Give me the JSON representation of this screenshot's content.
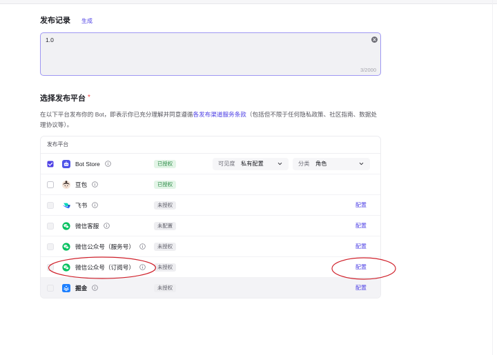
{
  "record": {
    "title": "发布记录",
    "generate_label": "生成",
    "value": "1.0",
    "counter": "3/2000"
  },
  "platform": {
    "title": "选择发布平台",
    "required_mark": "*",
    "desc_prefix": "在以下平台发布你的 Bot，即表示你已充分理解并同意遵循",
    "desc_link": "各发布渠道服务条款",
    "desc_suffix": "（包括但不限于任何隐私政策、社区指南、数据处理协议等）。",
    "table_header": "发布平台",
    "rows": [
      {
        "name": "Bot Store",
        "icon": "bot-store-icon",
        "checked": true,
        "disabled": false,
        "status": "已授权",
        "authorized": true,
        "visibility": {
          "label": "可见度",
          "value": "私有配置"
        },
        "category": {
          "label": "分类",
          "value": "角色"
        }
      },
      {
        "name": "豆包",
        "icon": "doubao-icon",
        "checked": false,
        "disabled": false,
        "status": "已授权",
        "authorized": true
      },
      {
        "name": "飞书",
        "icon": "feishu-icon",
        "checked": false,
        "disabled": true,
        "status": "未授权",
        "authorized": false,
        "action": "配置"
      },
      {
        "name": "微信客服",
        "icon": "wechat-icon",
        "checked": false,
        "disabled": true,
        "status": "未配置",
        "authorized": false,
        "action": "配置"
      },
      {
        "name": "微信公众号（服务号）",
        "icon": "wechat-icon",
        "checked": false,
        "disabled": true,
        "status": "未授权",
        "authorized": false,
        "action": "配置"
      },
      {
        "name": "微信公众号（订阅号）",
        "icon": "wechat-icon",
        "checked": false,
        "disabled": true,
        "status": "未授权",
        "authorized": false,
        "action": "配置",
        "annotated": true
      },
      {
        "name": "掘金",
        "icon": "juejin-icon",
        "checked": false,
        "disabled": true,
        "status": "未授权",
        "authorized": false,
        "action": "配置",
        "hovered": true
      }
    ]
  },
  "icons": {
    "clear": "clear-icon",
    "info": "info-icon",
    "chevron": "chevron-down-icon"
  },
  "colors": {
    "accent": "#4e40e5",
    "required": "#f53f3f",
    "annotation": "#d0202a",
    "authorized_bg": "#e3f5e7",
    "authorized_fg": "#2a8a45"
  }
}
